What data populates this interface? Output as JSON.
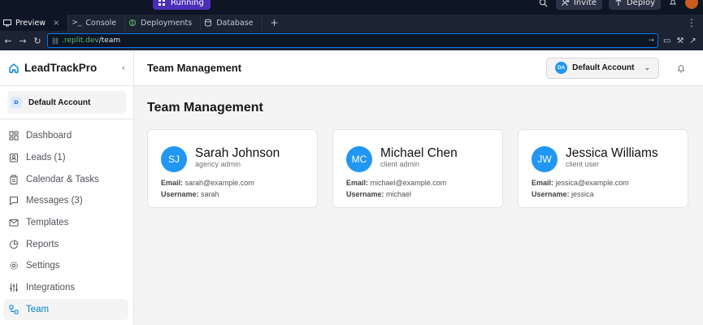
{
  "ide": {
    "run_status": "Running",
    "invite_label": "Invite",
    "deploy_label": "Deploy",
    "tabs": [
      {
        "label": "Preview"
      },
      {
        "label": "Console"
      },
      {
        "label": "Deployments"
      },
      {
        "label": "Database"
      }
    ],
    "url_domain": ".replit.dev",
    "url_path": "/team"
  },
  "app": {
    "brand": "LeadTrackPro",
    "account_badge": "D",
    "account_name": "Default Account",
    "nav": [
      {
        "label": "Dashboard",
        "icon": "grid-icon"
      },
      {
        "label": "Leads (1)",
        "icon": "contact-icon"
      },
      {
        "label": "Calendar & Tasks",
        "icon": "clipboard-icon"
      },
      {
        "label": "Messages (3)",
        "icon": "message-icon"
      },
      {
        "label": "Templates",
        "icon": "mail-icon"
      },
      {
        "label": "Reports",
        "icon": "pie-chart-icon"
      },
      {
        "label": "Settings",
        "icon": "gear-icon"
      },
      {
        "label": "Integrations",
        "icon": "sliders-icon"
      },
      {
        "label": "Team",
        "icon": "workflow-icon"
      }
    ],
    "active_nav": "Team"
  },
  "header": {
    "title": "Team Management",
    "account_initials": "DA",
    "account_label": "Default Account"
  },
  "page": {
    "title": "Team Management",
    "email_label": "Email:",
    "username_label": "Username:",
    "members": [
      {
        "initials": "SJ",
        "name": "Sarah Johnson",
        "role": "agency admin",
        "email": "sarah@example.com",
        "username": "sarah"
      },
      {
        "initials": "MC",
        "name": "Michael Chen",
        "role": "client admin",
        "email": "michael@example.com",
        "username": "michael"
      },
      {
        "initials": "JW",
        "name": "Jessica Williams",
        "role": "client user",
        "email": "jessica@example.com",
        "username": "jessica"
      }
    ]
  },
  "colors": {
    "accent": "#2196f3",
    "active_nav": "#0284c7",
    "run_pill": "#4b2fb8"
  }
}
